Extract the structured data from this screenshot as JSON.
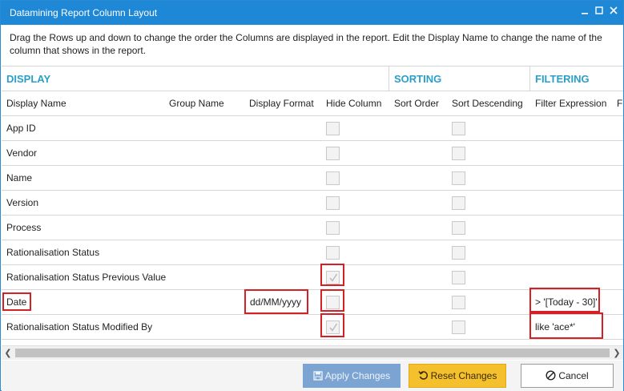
{
  "window": {
    "title": "Datamining Report Column Layout",
    "minimize_icon": "minimize-icon",
    "maximize_icon": "maximize-icon",
    "close_icon": "close-icon"
  },
  "instructions": "Drag the Rows up and down to change the order the Columns are displayed in the report. Edit the Display Name to change the name of the column that shows in the report.",
  "groups": {
    "display": "DISPLAY",
    "sorting": "SORTING",
    "filtering": "FILTERING"
  },
  "columns": {
    "display_name": "Display Name",
    "group_name": "Group Name",
    "display_format": "Display Format",
    "hide_column": "Hide Column",
    "sort_order": "Sort Order",
    "sort_descending": "Sort Descending",
    "filter_expression": "Filter Expression",
    "cut_off": "F"
  },
  "rows": [
    {
      "display_name": "App ID",
      "group_name": "",
      "display_format": "",
      "hide_column": false,
      "sort_order": "",
      "sort_descending": false,
      "filter_expression": ""
    },
    {
      "display_name": "Vendor",
      "group_name": "",
      "display_format": "",
      "hide_column": false,
      "sort_order": "",
      "sort_descending": false,
      "filter_expression": ""
    },
    {
      "display_name": "Name",
      "group_name": "",
      "display_format": "",
      "hide_column": false,
      "sort_order": "",
      "sort_descending": false,
      "filter_expression": ""
    },
    {
      "display_name": "Version",
      "group_name": "",
      "display_format": "",
      "hide_column": false,
      "sort_order": "",
      "sort_descending": false,
      "filter_expression": ""
    },
    {
      "display_name": "Process",
      "group_name": "",
      "display_format": "",
      "hide_column": false,
      "sort_order": "",
      "sort_descending": false,
      "filter_expression": ""
    },
    {
      "display_name": "Rationalisation Status",
      "group_name": "",
      "display_format": "",
      "hide_column": false,
      "sort_order": "",
      "sort_descending": false,
      "filter_expression": ""
    },
    {
      "display_name": "Rationalisation Status Previous Value",
      "group_name": "",
      "display_format": "",
      "hide_column": true,
      "sort_order": "",
      "sort_descending": false,
      "filter_expression": ""
    },
    {
      "display_name": "Date",
      "group_name": "",
      "display_format": "dd/MM/yyyy",
      "hide_column": false,
      "sort_order": "",
      "sort_descending": false,
      "filter_expression": "> '[Today - 30]'"
    },
    {
      "display_name": "Rationalisation Status Modified By",
      "group_name": "",
      "display_format": "",
      "hide_column": true,
      "sort_order": "",
      "sort_descending": false,
      "filter_expression": "like 'ace*'"
    }
  ],
  "buttons": {
    "apply": "Apply Changes",
    "reset": "Reset Changes",
    "cancel": "Cancel"
  },
  "colors": {
    "titlebar": "#1e88d6",
    "group_header": "#2a9fc8",
    "highlight": "#d71f26",
    "apply_button": "#7ca4d3",
    "reset_button": "#f5c02d"
  }
}
